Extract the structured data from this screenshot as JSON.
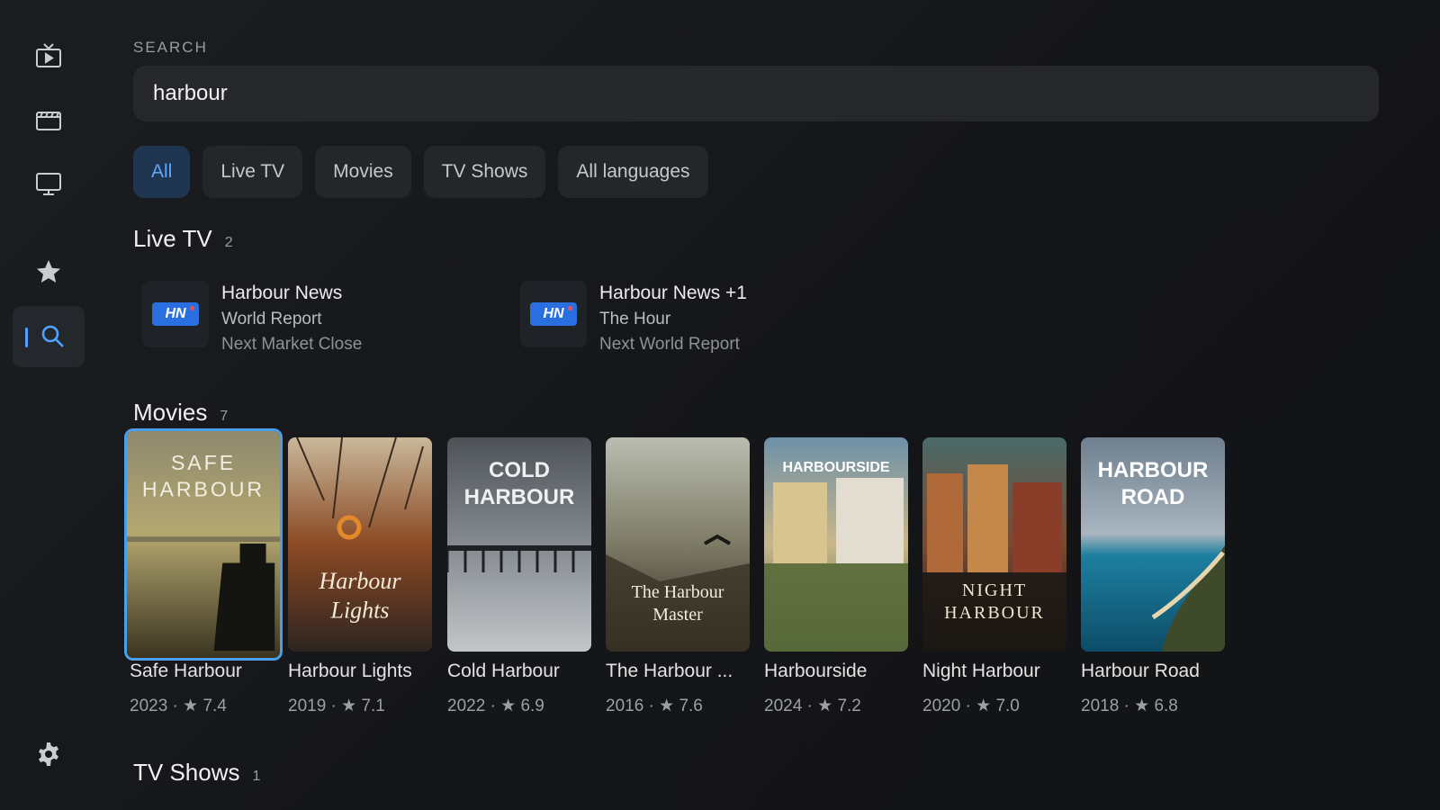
{
  "sidebar": {
    "items": [
      {
        "icon": "live-tv-icon"
      },
      {
        "icon": "clapperboard-icon"
      },
      {
        "icon": "monitor-icon"
      },
      {
        "icon": "star-icon"
      },
      {
        "icon": "search-icon",
        "active": true
      }
    ],
    "settings_icon": "gear-icon"
  },
  "search": {
    "label": "SEARCH",
    "query": "harbour"
  },
  "filters": [
    "All",
    "Live TV",
    "Movies",
    "TV Shows",
    "All languages"
  ],
  "live_tv": {
    "title": "Live TV",
    "count": "2",
    "channels": [
      {
        "logo": "HN",
        "name": "Harbour News",
        "now": "World Report",
        "next": "Next Market Close"
      },
      {
        "logo": "HN",
        "name": "Harbour News +1",
        "now": "The Hour",
        "next": "Next World Report"
      }
    ]
  },
  "movies": {
    "title": "Movies",
    "count": "7",
    "items": [
      {
        "poster_text": "SAFE HARBOUR",
        "title": "Safe Harbour",
        "meta": "2023 · ★ 7.4"
      },
      {
        "poster_text": "Harbour Lights",
        "title": "Harbour Lights",
        "meta": "2019 · ★ 7.1"
      },
      {
        "poster_text": "COLD HARBOUR",
        "title": "Cold Harbour",
        "meta": "2022 · ★ 6.9"
      },
      {
        "poster_text": "The Harbour Master",
        "title": "The Harbour ...",
        "meta": "2016 · ★ 7.6"
      },
      {
        "poster_text": "HARBOURSIDE",
        "title": "Harbourside",
        "meta": "2024 · ★ 7.2"
      },
      {
        "poster_text": "NIGHT HARBOUR",
        "title": "Night Harbour",
        "meta": "2020 · ★ 7.0"
      },
      {
        "poster_text": "HARBOUR ROAD",
        "title": "Harbour Road",
        "meta": "2018 · ★ 6.8"
      }
    ]
  },
  "tv_shows": {
    "title": "TV Shows",
    "count": "1"
  },
  "colors": {
    "accent": "#4da3ff",
    "focus_border": "#4a9eea",
    "background": "#16171a"
  }
}
